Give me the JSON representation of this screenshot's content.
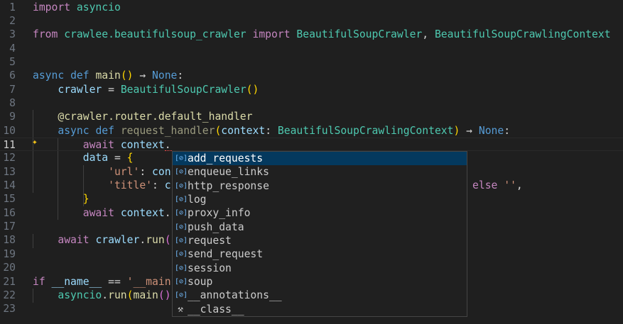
{
  "editor": {
    "current_line": 11,
    "lines": [
      {
        "n": "1",
        "t": [
          [
            "kw",
            "import"
          ],
          [
            "op",
            " "
          ],
          [
            "mod",
            "asyncio"
          ]
        ]
      },
      {
        "n": "2",
        "t": []
      },
      {
        "n": "3",
        "t": [
          [
            "kw",
            "from"
          ],
          [
            "op",
            " "
          ],
          [
            "mod",
            "crawlee.beautifulsoup_crawler"
          ],
          [
            "op",
            " "
          ],
          [
            "kw",
            "import"
          ],
          [
            "op",
            " "
          ],
          [
            "mod",
            "BeautifulSoupCrawler"
          ],
          [
            "op",
            ", "
          ],
          [
            "mod",
            "BeautifulSoupCrawlingContext"
          ]
        ]
      },
      {
        "n": "4",
        "t": []
      },
      {
        "n": "5",
        "t": []
      },
      {
        "n": "6",
        "t": [
          [
            "bl",
            "async"
          ],
          [
            "op",
            " "
          ],
          [
            "bl",
            "def"
          ],
          [
            "op",
            " "
          ],
          [
            "fn",
            "main"
          ],
          [
            "br",
            "()"
          ],
          [
            "op",
            " → "
          ],
          [
            "bl",
            "None"
          ],
          [
            "op",
            ":"
          ]
        ]
      },
      {
        "n": "7",
        "t": [
          [
            "op",
            "    "
          ],
          [
            "var",
            "crawler"
          ],
          [
            "op",
            " = "
          ],
          [
            "mod",
            "BeautifulSoupCrawler"
          ],
          [
            "br",
            "()"
          ]
        ]
      },
      {
        "n": "8",
        "t": []
      },
      {
        "n": "9",
        "t": [
          [
            "op",
            "    "
          ],
          [
            "fn",
            "@crawler.router.default_handler"
          ]
        ]
      },
      {
        "n": "10",
        "t": [
          [
            "op",
            "    "
          ],
          [
            "bl",
            "async"
          ],
          [
            "op",
            " "
          ],
          [
            "bl",
            "def"
          ],
          [
            "op",
            " "
          ],
          [
            "dim",
            "request_handler"
          ],
          [
            "br",
            "("
          ],
          [
            "var",
            "context"
          ],
          [
            "op",
            ": "
          ],
          [
            "mod",
            "BeautifulSoupCrawlingContext"
          ],
          [
            "br",
            ")"
          ],
          [
            "op",
            " → "
          ],
          [
            "bl",
            "None"
          ],
          [
            "op",
            ":"
          ]
        ]
      },
      {
        "n": "11",
        "t": [
          [
            "op",
            "        "
          ],
          [
            "kw",
            "await"
          ],
          [
            "op",
            " "
          ],
          [
            "var",
            "context"
          ],
          [
            "op",
            "."
          ]
        ]
      },
      {
        "n": "12",
        "t": [
          [
            "op",
            "        "
          ],
          [
            "var",
            "data"
          ],
          [
            "op",
            " = "
          ],
          [
            "br",
            "{"
          ]
        ]
      },
      {
        "n": "13",
        "t": [
          [
            "op",
            "            "
          ],
          [
            "str",
            "'url'"
          ],
          [
            "op",
            ": "
          ],
          [
            "var",
            "con"
          ]
        ]
      },
      {
        "n": "14",
        "t": [
          [
            "op",
            "            "
          ],
          [
            "str",
            "'title'"
          ],
          [
            "op",
            ": "
          ],
          [
            "var",
            "c"
          ],
          [
            "op",
            "                                                "
          ],
          [
            "kw",
            "else"
          ],
          [
            "op",
            " "
          ],
          [
            "str",
            "''"
          ],
          [
            "op",
            ","
          ]
        ]
      },
      {
        "n": "15",
        "t": [
          [
            "op",
            "        "
          ],
          [
            "br",
            "}"
          ]
        ]
      },
      {
        "n": "16",
        "t": [
          [
            "op",
            "        "
          ],
          [
            "kw",
            "await"
          ],
          [
            "op",
            " "
          ],
          [
            "var",
            "context"
          ],
          [
            "op",
            "."
          ]
        ]
      },
      {
        "n": "17",
        "t": []
      },
      {
        "n": "18",
        "t": [
          [
            "op",
            "    "
          ],
          [
            "kw",
            "await"
          ],
          [
            "op",
            " "
          ],
          [
            "var",
            "crawler"
          ],
          [
            "op",
            "."
          ],
          [
            "fn",
            "run"
          ],
          [
            "br2",
            "("
          ]
        ]
      },
      {
        "n": "19",
        "t": []
      },
      {
        "n": "20",
        "t": []
      },
      {
        "n": "21",
        "t": [
          [
            "kw",
            "if"
          ],
          [
            "op",
            " "
          ],
          [
            "var",
            "__name__"
          ],
          [
            "op",
            " == "
          ],
          [
            "str",
            "'__main"
          ]
        ]
      },
      {
        "n": "22",
        "t": [
          [
            "op",
            "    "
          ],
          [
            "mod",
            "asyncio"
          ],
          [
            "op",
            "."
          ],
          [
            "fn",
            "run"
          ],
          [
            "br",
            "("
          ],
          [
            "fn",
            "main"
          ],
          [
            "br2",
            "()"
          ]
        ]
      },
      {
        "n": "23",
        "t": []
      }
    ]
  },
  "suggest": {
    "selected": 0,
    "items": [
      {
        "label": "add_requests",
        "icon": "field-icon"
      },
      {
        "label": "enqueue_links",
        "icon": "field-icon"
      },
      {
        "label": "http_response",
        "icon": "field-icon"
      },
      {
        "label": "log",
        "icon": "field-icon"
      },
      {
        "label": "proxy_info",
        "icon": "field-icon"
      },
      {
        "label": "push_data",
        "icon": "field-icon"
      },
      {
        "label": "request",
        "icon": "field-icon"
      },
      {
        "label": "send_request",
        "icon": "field-icon"
      },
      {
        "label": "session",
        "icon": "field-icon"
      },
      {
        "label": "soup",
        "icon": "field-icon"
      },
      {
        "label": "__annotations__",
        "icon": "field-icon"
      },
      {
        "label": "__class__",
        "icon": "wrench-icon"
      }
    ]
  }
}
